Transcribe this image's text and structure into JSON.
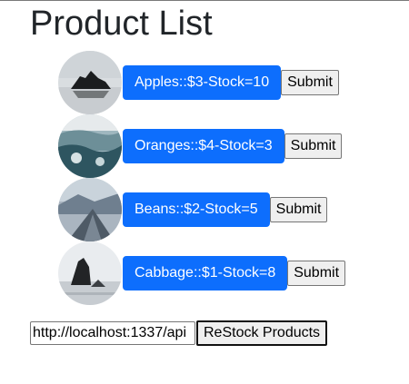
{
  "page": {
    "title": "Product List"
  },
  "products": [
    {
      "label": "Apples::$3-Stock=10",
      "submit_label": "Submit",
      "image_icon": "product-photo-icon"
    },
    {
      "label": "Oranges::$4-Stock=3",
      "submit_label": "Submit",
      "image_icon": "product-photo-icon"
    },
    {
      "label": "Beans::$2-Stock=5",
      "submit_label": "Submit",
      "image_icon": "product-photo-icon"
    },
    {
      "label": "Cabbage::$1-Stock=8",
      "submit_label": "Submit",
      "image_icon": "product-photo-icon"
    }
  ],
  "restock": {
    "url_value": "http://localhost:1337/api",
    "button_label": "ReStock Products"
  },
  "colors": {
    "primary_button": "#0d6efd",
    "title_text": "#212529"
  }
}
